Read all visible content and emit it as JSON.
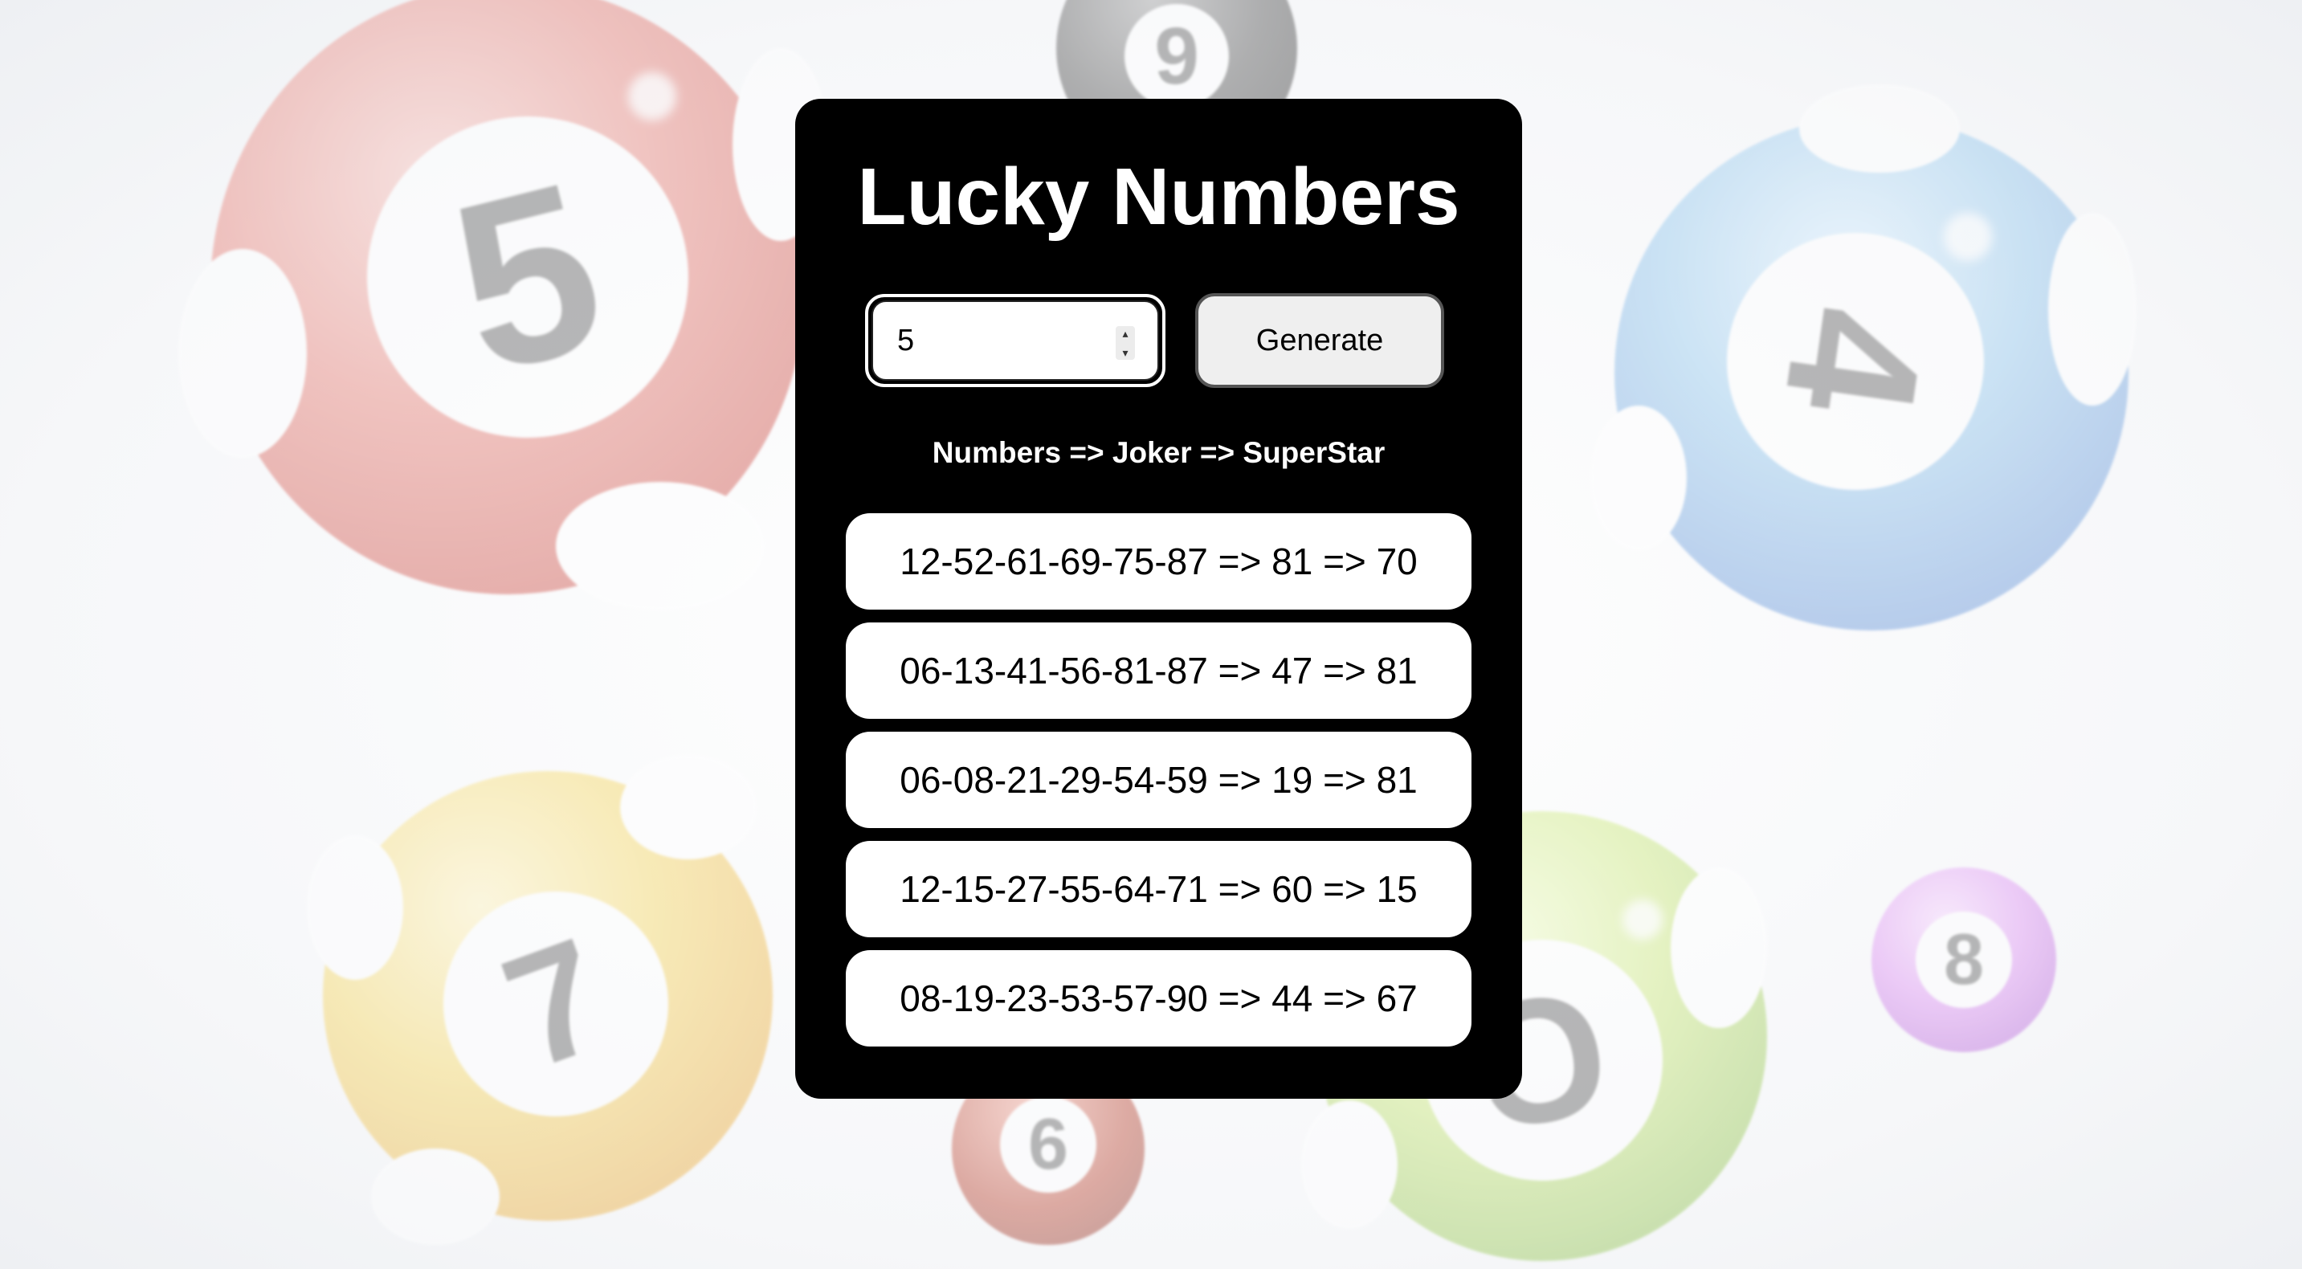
{
  "app": {
    "title": "Lucky Numbers"
  },
  "controls": {
    "count_value": "5",
    "generate_label": "Generate"
  },
  "legend": "Numbers => Joker => SuperStar",
  "results": [
    "12-52-61-69-75-87 => 81 => 70",
    "06-13-41-56-81-87 => 47 => 81",
    "06-08-21-29-54-59 => 19 => 81",
    "12-15-27-55-64-71 => 60 => 15",
    "08-19-23-53-57-90 => 44 => 67"
  ],
  "background_balls": [
    {
      "id": "red",
      "number": "5",
      "color": "#e67a70"
    },
    {
      "id": "blue",
      "number": "4",
      "color": "#8cc4ec"
    },
    {
      "id": "yellow",
      "number": "7",
      "color": "#f5d55a"
    },
    {
      "id": "green",
      "number": "C",
      "color": "#c9e874"
    },
    {
      "id": "purple",
      "number": "8",
      "color": "#dc8cf2"
    },
    {
      "id": "black",
      "number": "9",
      "color": "#4a4a4a"
    },
    {
      "id": "darkred",
      "number": "6",
      "color": "#b8402c"
    }
  ],
  "colors": {
    "card_background": "#000000",
    "text_on_card": "#ffffff",
    "result_background": "#ffffff",
    "button_background": "#efefef"
  }
}
